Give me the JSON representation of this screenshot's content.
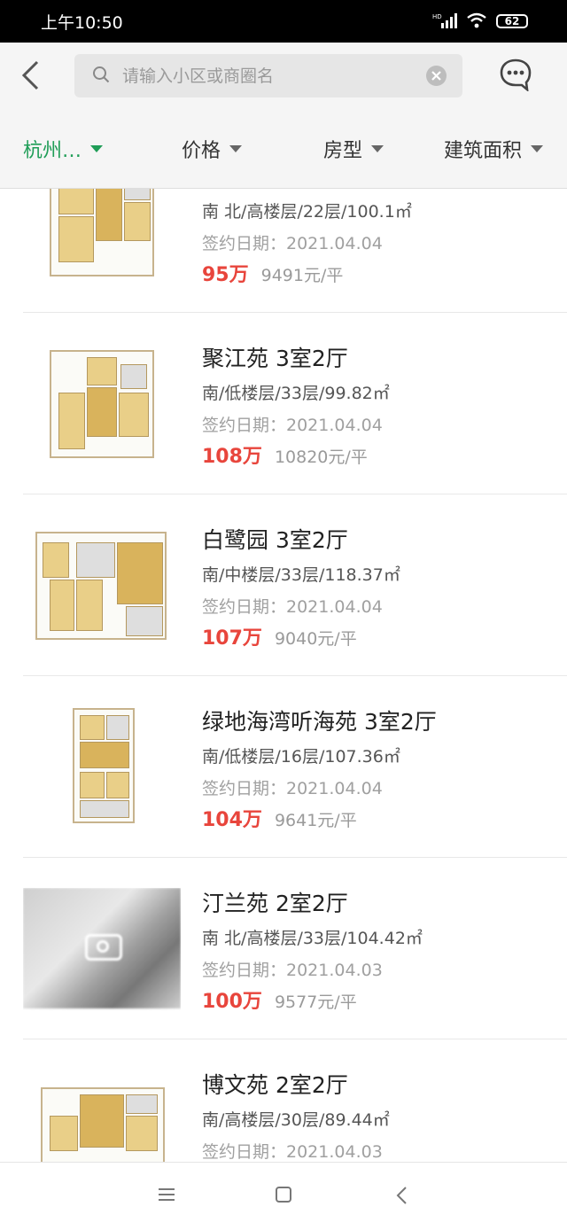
{
  "status_bar": {
    "time": "上午10:50",
    "network": "HD",
    "battery": "62"
  },
  "search": {
    "placeholder": "请输入小区或商圈名",
    "value": ""
  },
  "filters": [
    {
      "label": "杭州…",
      "active": true
    },
    {
      "label": "价格",
      "active": false
    },
    {
      "label": "房型",
      "active": false
    },
    {
      "label": "建筑面积",
      "active": false
    }
  ],
  "listings": [
    {
      "title": "",
      "info": "南 北/高楼层/22层/100.1㎡",
      "date": "签约日期：2021.04.04",
      "price": "95万",
      "unit_price": "9491元/平",
      "thumb": "floorplan"
    },
    {
      "title": "聚江苑 3室2厅",
      "info": "南/低楼层/33层/99.82㎡",
      "date": "签约日期：2021.04.04",
      "price": "108万",
      "unit_price": "10820元/平",
      "thumb": "floorplan"
    },
    {
      "title": "白鹭园 3室2厅",
      "info": "南/中楼层/33层/118.37㎡",
      "date": "签约日期：2021.04.04",
      "price": "107万",
      "unit_price": "9040元/平",
      "thumb": "floorplan"
    },
    {
      "title": "绿地海湾听海苑 3室2厅",
      "info": "南/低楼层/16层/107.36㎡",
      "date": "签约日期：2021.04.04",
      "price": "104万",
      "unit_price": "9641元/平",
      "thumb": "floorplan"
    },
    {
      "title": "汀兰苑 2室2厅",
      "info": "南 北/高楼层/33层/104.42㎡",
      "date": "签约日期：2021.04.03",
      "price": "100万",
      "unit_price": "9577元/平",
      "thumb": "photo"
    },
    {
      "title": "博文苑 2室2厅",
      "info": "南/高楼层/30层/89.44㎡",
      "date": "签约日期：2021.04.03",
      "price": "",
      "unit_price": "",
      "thumb": "floorplan"
    }
  ],
  "colors": {
    "accent": "#1f9d57",
    "price": "#e8453c"
  },
  "icons": [
    "back-arrow-icon",
    "search-icon",
    "clear-icon",
    "chat-bubble-icon",
    "menu-icon",
    "home-square-icon",
    "nav-back-icon"
  ]
}
